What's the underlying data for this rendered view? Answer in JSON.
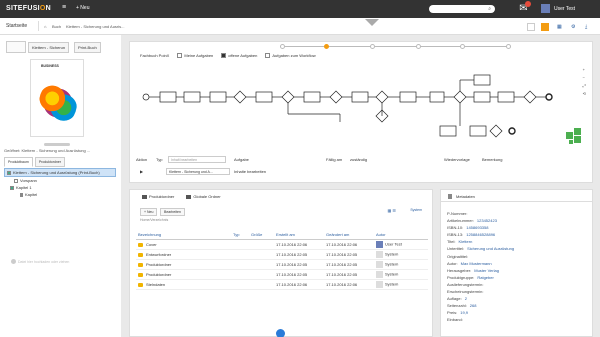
{
  "topbar": {
    "logo_main": "SITEFUSI",
    "logo_accent": "O",
    "logo_end": "N",
    "new_label": "+ Neu",
    "user_label": "User Test"
  },
  "subbar": {
    "start_label": "Startseite",
    "crumb1": "Buch",
    "crumb2": "Klettern - Sicherung und Ausris..."
  },
  "left": {
    "tab1": "Klettern - Sicherun",
    "tab2": "Print-Buch",
    "cover_title": "BUSINESS",
    "link_row": "Geöffnet:  Klettern - Sicherung und Ausrüstung ...",
    "subtab1": "Produktbaum",
    "subtab2": "Produktordner",
    "tree": [
      {
        "label": "Klettern - Sicherung und Ausrüstung (Print-Buch)"
      },
      {
        "label": "Vorspann"
      },
      {
        "label": "Kapitel 1"
      },
      {
        "label": "Kapitel"
      }
    ],
    "upload_label": "Datei hier hochladen oder ziehen"
  },
  "workflow": {
    "filter_label": "Fachbuch PoinX",
    "filters": [
      {
        "label": "Meine Aufgaben",
        "checked": false
      },
      {
        "label": "offene Aufgaben",
        "checked": true
      },
      {
        "label": "Aufgaben zum Workflow",
        "checked": false
      }
    ],
    "headers": {
      "aktion": "Aktion",
      "typ": "Typ",
      "aufgabe": "Aufgabe",
      "faellig": "Fällig am",
      "zustaendig": "zuständig",
      "wiedervorlage": "Wiedervorlage",
      "bemerkung": "Bemerkung"
    },
    "typ_placeholder": "Inhalt bearbeiten",
    "row": {
      "aufgabe_input": "Klettern - Sicherung und A...",
      "aufgabe_text": "Inhalte bearbeiten"
    },
    "tools": [
      "+",
      "−",
      "⤢",
      "⟲"
    ]
  },
  "files": {
    "tab1": "Produktordner",
    "tab2": "Globale Ordner",
    "btn_new": "+ Neu",
    "btn_edit": "Bearbeiten",
    "path": "Home/Verzeichnis",
    "view_label": "System",
    "columns": [
      "Bezeichnung",
      "Typ",
      "Größe",
      "Erstellt am",
      "Geändert am",
      "Autor"
    ],
    "rows": [
      {
        "name": "Cover",
        "typ": "",
        "size": "",
        "created": "17.10.2016 22:06",
        "modified": "17.10.2016 22:06",
        "author": "User Test",
        "user": true
      },
      {
        "name": "Entwurfordner",
        "typ": "",
        "size": "",
        "created": "17.10.2016 22:05",
        "modified": "17.10.2016 22:05",
        "author": "System",
        "user": false
      },
      {
        "name": "Produktordner",
        "typ": "",
        "size": "",
        "created": "17.10.2016 22:05",
        "modified": "17.10.2016 22:05",
        "author": "System",
        "user": false
      },
      {
        "name": "Produktordner",
        "typ": "",
        "size": "",
        "created": "17.10.2016 22:05",
        "modified": "17.10.2016 22:05",
        "author": "System",
        "user": false
      },
      {
        "name": "Stelndaten",
        "typ": "",
        "size": "",
        "created": "17.10.2016 22:06",
        "modified": "17.10.2016 22:06",
        "author": "System",
        "user": false
      }
    ]
  },
  "meta": {
    "title": "Metadaten",
    "rows": [
      {
        "k": "P-Nummer:",
        "v": ""
      },
      {
        "k": "Artikelnummer:",
        "v": "123452423"
      },
      {
        "k": "ISBN-10:",
        "v": "1458693358"
      },
      {
        "k": "ISBN-13:",
        "v": "1258846528896"
      },
      {
        "k": "Titel:",
        "v": "Klettern"
      },
      {
        "k": "Untertitel:",
        "v": "Sicherung und Ausrüstung"
      },
      {
        "k": "Originaltitel:",
        "v": ""
      },
      {
        "k": "Autor:",
        "v": "Max Mustermann"
      },
      {
        "k": "Herausgeber:",
        "v": "Muster Verlag"
      },
      {
        "k": "Produktgruppe:",
        "v": "Ratgeber"
      },
      {
        "k": "Auslieferungstermin:",
        "v": ""
      },
      {
        "k": "Erscheinungstermin:",
        "v": ""
      },
      {
        "k": "Auflage:",
        "v": "2"
      },
      {
        "k": "Seitenzahl:",
        "v": "268"
      },
      {
        "k": "Preis:",
        "v": "19,9"
      },
      {
        "k": "Einband:",
        "v": ""
      }
    ]
  }
}
